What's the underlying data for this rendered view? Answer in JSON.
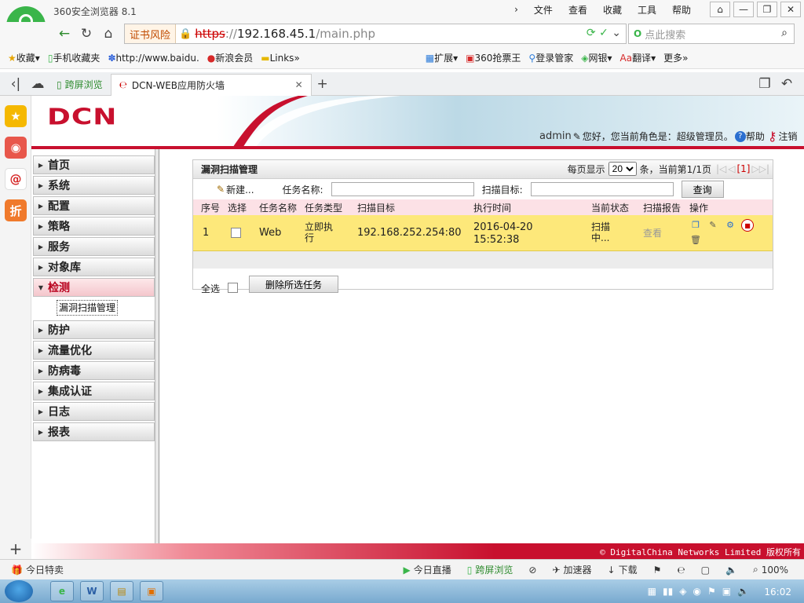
{
  "browser": {
    "app_title": "360安全浏览器 8.1",
    "menu": [
      "文件",
      "查看",
      "收藏",
      "工具",
      "帮助"
    ],
    "cert_warning": "证书风险",
    "url_scheme": "https",
    "url_sep": "://",
    "url_host": "192.168.45.1",
    "url_path": "/main.php",
    "search_placeholder": "点此搜索",
    "bookmarks": [
      "收藏",
      "手机收藏夹",
      "http://www.baidu.",
      "新浪会员",
      "Links"
    ],
    "bookmarks_right": [
      "扩展",
      "360抢票王",
      "登录管家",
      "网银",
      "翻译",
      "更多"
    ],
    "tabs": [
      {
        "label": "跨屏浏览"
      },
      {
        "label": "DCN-WEB应用防火墙"
      }
    ]
  },
  "app": {
    "brand": "DCN",
    "user": "admin",
    "role_text": "您好，您当前角色是：超级管理员。",
    "help": "帮助",
    "logout": "注销",
    "menu": [
      {
        "label": "首页"
      },
      {
        "label": "系统"
      },
      {
        "label": "配置"
      },
      {
        "label": "策略"
      },
      {
        "label": "服务"
      },
      {
        "label": "对象库"
      },
      {
        "label": "检测"
      },
      {
        "label": "防护"
      },
      {
        "label": "流量优化"
      },
      {
        "label": "防病毒"
      },
      {
        "label": "集成认证"
      },
      {
        "label": "日志"
      },
      {
        "label": "报表"
      }
    ],
    "submenu_item": "漏洞扫描管理",
    "footer": "© DigitalChina Networks Limited 版权所有"
  },
  "panel": {
    "title": "漏洞扫描管理",
    "per_page_label": "每页显示",
    "per_page_value": "20",
    "per_page_unit": "条，当前第1/1页",
    "page_current": "[1]",
    "new_label": "新建...",
    "task_name_label": "任务名称:",
    "scan_target_label": "扫描目标:",
    "query_button": "查询",
    "columns": [
      "序号",
      "选择",
      "任务名称",
      "任务类型",
      "扫描目标",
      "执行时间",
      "当前状态",
      "扫描报告",
      "操作"
    ],
    "rows": [
      {
        "index": "1",
        "name": "Web",
        "type": "立即执行",
        "target": "192.168.252.254:80",
        "time_date": "2016-04-20",
        "time_clock": "15:52:38",
        "status": "扫描中...",
        "report": "查看"
      }
    ],
    "select_all": "全选",
    "delete_selected": "删除所选任务"
  },
  "statusbar": {
    "left": "今日特卖",
    "items": [
      "今日直播",
      "跨屏浏览",
      "加速器",
      "下载"
    ],
    "zoom": "100%"
  },
  "taskbar": {
    "clock": "16:02"
  }
}
